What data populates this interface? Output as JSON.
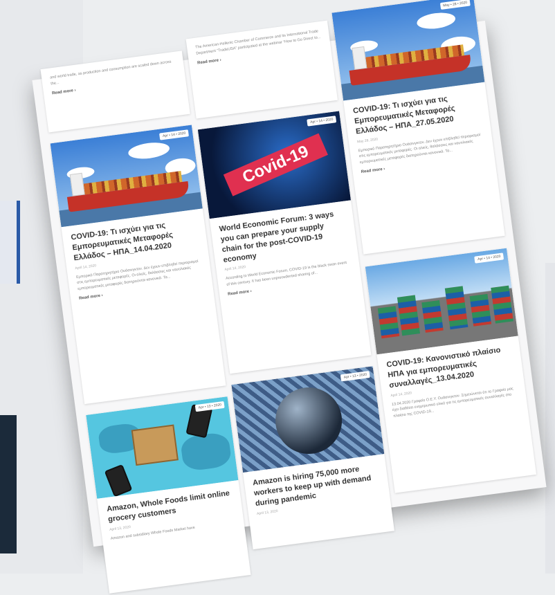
{
  "posts": [
    {
      "badge": "",
      "title": "",
      "date": "",
      "excerpt": "and world trade, as production and consumption are scaled down across the...",
      "more": "Read more ›"
    },
    {
      "badge": "Apr • 14 • 2020",
      "title": "COVID-19: Τι ισχύει για τις Εμπορευματικές Μεταφορές Ελλάδος – ΗΠΑ_14.04.2020",
      "date": "April 14, 2020",
      "excerpt": "Εμπορικό Παρατηρητήριο Ουάσινγκτον. Δεν έχουν επιβληθεί περιορισμοί στις εμπορευματικές μεταφορές. Οι αλιείς, θαλάσσιες και ναυτιλιακές εμπορευματικές μεταφορές διατηρούνται κανονικά. Τα...",
      "more": "Read more ›"
    },
    {
      "badge": "Apr • 13 • 2020",
      "title": "Amazon, Whole Foods limit online grocery customers",
      "date": "April 13, 2020",
      "excerpt": "Amazon and subsidiary Whole Foods Market have",
      "more": ""
    },
    {
      "badge": "",
      "title": "",
      "date": "",
      "excerpt": "The American-Hellenic Chamber of Commerce and its International Trade Department “TradeUSA” participated at the webinar “How to Go Direct to...",
      "more": "Read more ›"
    },
    {
      "badge": "Apr • 14 • 2020",
      "title": "World Economic Forum: 3 ways you can prepare your supply chain for the post-COVID-19 economy",
      "date": "April 14, 2020",
      "excerpt": "According to World Economic Forum, COVID-19 is the black swan event of this century. It has been unprecedented sharing of...",
      "more": "Read more ›"
    },
    {
      "badge": "Apr • 13 • 2020",
      "title": "Amazon is hiring 75,000 more workers to keep up with demand during pandemic",
      "date": "April 13, 2020",
      "excerpt": "",
      "more": ""
    },
    {
      "badge": "May • 28 • 2020",
      "title": "COVID-19: Τι ισχύει για τις Εμπορευματικές Μεταφορές Ελλάδος – ΗΠΑ_27.05.2020",
      "date": "May 28, 2020",
      "excerpt": "Εμπορικό Παρατηρητήριο Ουάσινγκτον. Δεν έχουν επιβληθεί περιορισμοί στις εμπορευματικές μεταφορές. Οι αλιείς, θαλάσσιες και ναυτιλιακές εμπορευματικές μεταφορές διατηρούνται κανονικά. Τα...",
      "more": "Read more ›"
    },
    {
      "badge": "Apr • 14 • 2020",
      "title": "COVID-19: Κανονιστικό πλαίσιο ΗΠΑ για εμπορευματικές συναλλαγές_13.04.2020",
      "date": "April 14, 2020",
      "excerpt": "13.04.2020 Γραφείο Ο.Ε.Υ. Ουάσινγκτον. Σημειώνεται ότι το Γραφείο μας έχει διαθέσει ενημερωτικό υλικό για τις εμπορευματικές συναλλαγές στο πλαίσιο της COVID-19...",
      "more": ""
    }
  ],
  "images": {
    "covid_text": "Covid-19"
  },
  "colors": {
    "sheet": "#f7f7f8",
    "hull": "#c53228",
    "covid_band": "#e03050"
  }
}
